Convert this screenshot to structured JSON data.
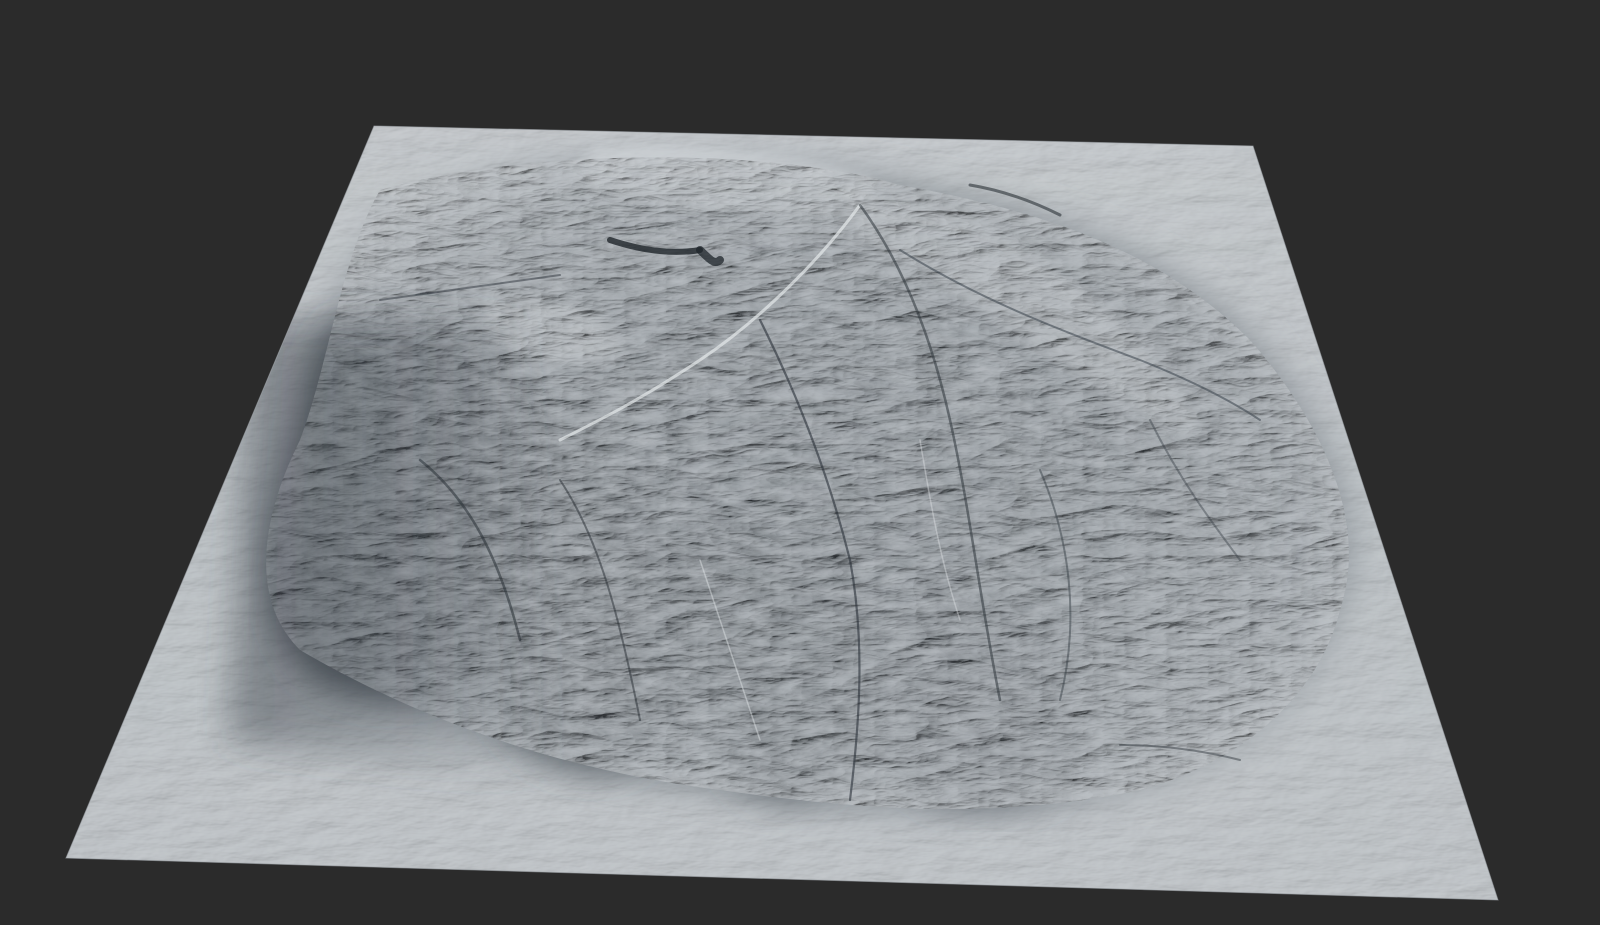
{
  "scene": {
    "background_color": "#2b2b2b",
    "subject": "terrain-heightmap-render",
    "material": "grey-clay",
    "colors": {
      "plain": "#b9bfc4",
      "plain_light": "#d3d7da",
      "ridge_light": "#e2e5e7",
      "mid_slope": "#8a9197",
      "shadow": "#424a52",
      "deep_shadow": "#262c33"
    }
  }
}
